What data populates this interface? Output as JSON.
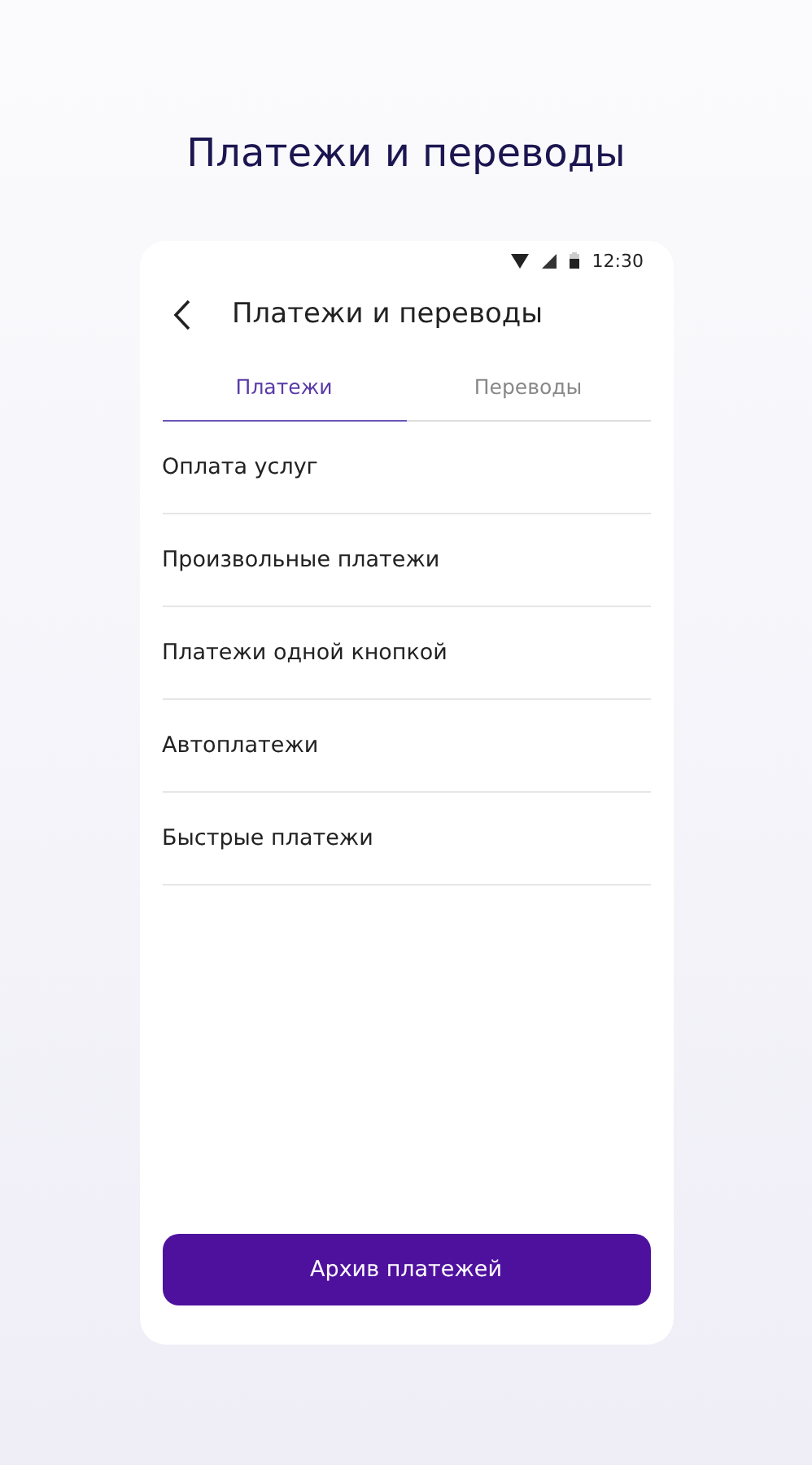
{
  "page_title": "Платежи и переводы",
  "status_bar": {
    "time": "12:30"
  },
  "header": {
    "title": "Платежи и переводы"
  },
  "tabs": [
    {
      "label": "Платежи",
      "selected": true
    },
    {
      "label": "Переводы",
      "selected": false
    }
  ],
  "menu_items": [
    "Оплата услуг",
    "Произвольные платежи",
    "Платежи одной кнопкой",
    "Автоплатежи",
    "Быстрые платежи"
  ],
  "primary_button": "Архив платежей"
}
